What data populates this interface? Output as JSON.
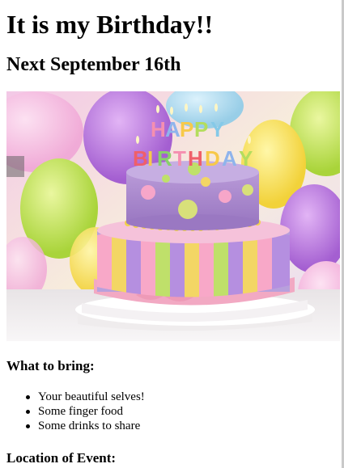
{
  "page": {
    "title": "It is my Birthday!!",
    "date_heading": "Next September 16th"
  },
  "hero_image": {
    "subject": "birthday-cake",
    "candle_text": "HAPPY BIRTHDAY"
  },
  "bring_section": {
    "heading": "What to bring:",
    "items": [
      "Your beautiful selves!",
      "Some finger food",
      "Some drinks to share"
    ]
  },
  "location_section": {
    "heading": "Location of Event:"
  },
  "colors": {
    "text": "#000000",
    "background": "#ffffff"
  }
}
